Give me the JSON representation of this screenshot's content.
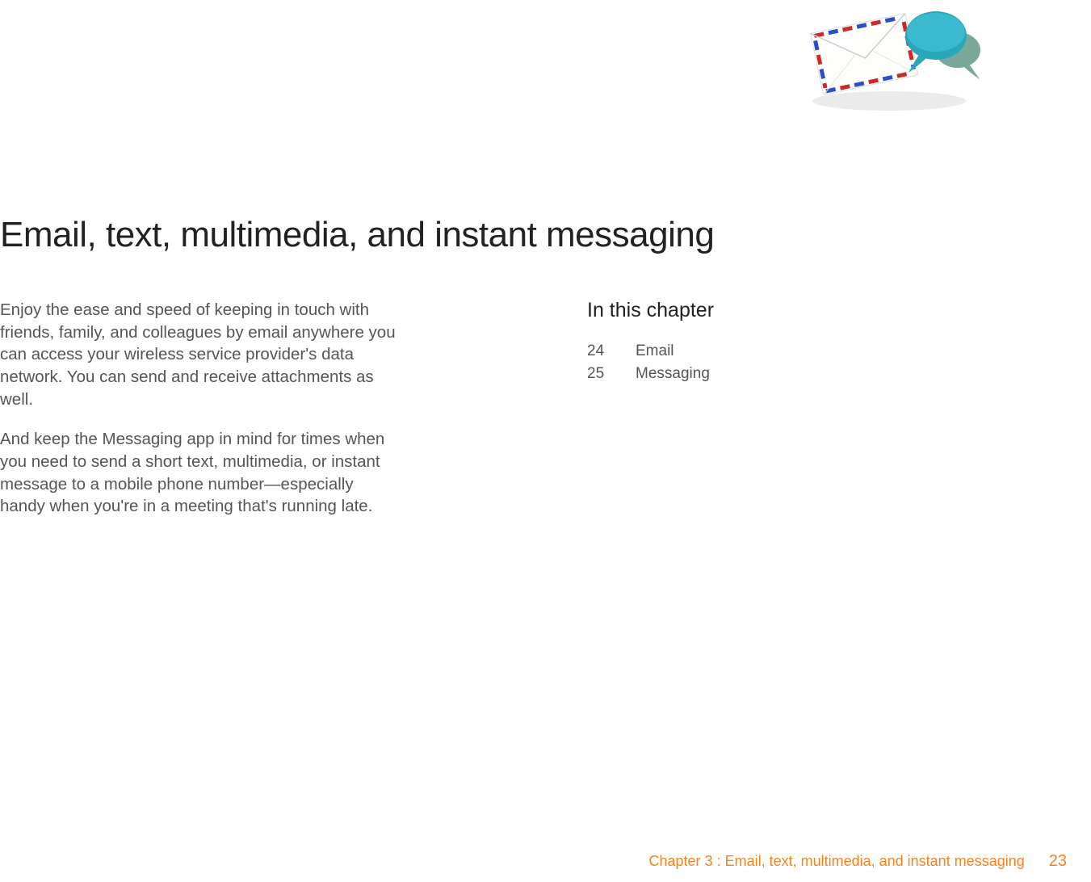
{
  "title": "Email, text, multimedia, and instant messaging",
  "intro": {
    "p1": "Enjoy the ease and speed of keeping in touch with friends, family, and colleagues by email anywhere you can access your wireless service provider's data network. You can send and receive attachments as well.",
    "p2": "And keep the Messaging app in mind for times when you need to send a short text, multimedia, or instant message to a mobile phone number—especially handy when you're in a meeting that's running late."
  },
  "toc": {
    "heading": "In this chapter",
    "items": [
      {
        "page": "24",
        "label": "Email"
      },
      {
        "page": "25",
        "label": "Messaging"
      }
    ]
  },
  "footer": {
    "chapter_label": "Chapter 3  :  Email, text, multimedia, and instant messaging",
    "page_number": "23"
  }
}
